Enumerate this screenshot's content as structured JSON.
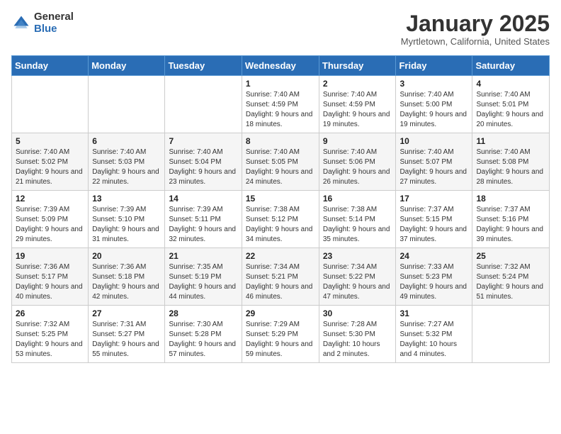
{
  "header": {
    "logo_general": "General",
    "logo_blue": "Blue",
    "month_title": "January 2025",
    "location": "Myrtletown, California, United States"
  },
  "weekdays": [
    "Sunday",
    "Monday",
    "Tuesday",
    "Wednesday",
    "Thursday",
    "Friday",
    "Saturday"
  ],
  "weeks": [
    [
      {
        "day": "",
        "sunrise": "",
        "sunset": "",
        "daylight": ""
      },
      {
        "day": "",
        "sunrise": "",
        "sunset": "",
        "daylight": ""
      },
      {
        "day": "",
        "sunrise": "",
        "sunset": "",
        "daylight": ""
      },
      {
        "day": "1",
        "sunrise": "Sunrise: 7:40 AM",
        "sunset": "Sunset: 4:59 PM",
        "daylight": "Daylight: 9 hours and 18 minutes."
      },
      {
        "day": "2",
        "sunrise": "Sunrise: 7:40 AM",
        "sunset": "Sunset: 4:59 PM",
        "daylight": "Daylight: 9 hours and 19 minutes."
      },
      {
        "day": "3",
        "sunrise": "Sunrise: 7:40 AM",
        "sunset": "Sunset: 5:00 PM",
        "daylight": "Daylight: 9 hours and 19 minutes."
      },
      {
        "day": "4",
        "sunrise": "Sunrise: 7:40 AM",
        "sunset": "Sunset: 5:01 PM",
        "daylight": "Daylight: 9 hours and 20 minutes."
      }
    ],
    [
      {
        "day": "5",
        "sunrise": "Sunrise: 7:40 AM",
        "sunset": "Sunset: 5:02 PM",
        "daylight": "Daylight: 9 hours and 21 minutes."
      },
      {
        "day": "6",
        "sunrise": "Sunrise: 7:40 AM",
        "sunset": "Sunset: 5:03 PM",
        "daylight": "Daylight: 9 hours and 22 minutes."
      },
      {
        "day": "7",
        "sunrise": "Sunrise: 7:40 AM",
        "sunset": "Sunset: 5:04 PM",
        "daylight": "Daylight: 9 hours and 23 minutes."
      },
      {
        "day": "8",
        "sunrise": "Sunrise: 7:40 AM",
        "sunset": "Sunset: 5:05 PM",
        "daylight": "Daylight: 9 hours and 24 minutes."
      },
      {
        "day": "9",
        "sunrise": "Sunrise: 7:40 AM",
        "sunset": "Sunset: 5:06 PM",
        "daylight": "Daylight: 9 hours and 26 minutes."
      },
      {
        "day": "10",
        "sunrise": "Sunrise: 7:40 AM",
        "sunset": "Sunset: 5:07 PM",
        "daylight": "Daylight: 9 hours and 27 minutes."
      },
      {
        "day": "11",
        "sunrise": "Sunrise: 7:40 AM",
        "sunset": "Sunset: 5:08 PM",
        "daylight": "Daylight: 9 hours and 28 minutes."
      }
    ],
    [
      {
        "day": "12",
        "sunrise": "Sunrise: 7:39 AM",
        "sunset": "Sunset: 5:09 PM",
        "daylight": "Daylight: 9 hours and 29 minutes."
      },
      {
        "day": "13",
        "sunrise": "Sunrise: 7:39 AM",
        "sunset": "Sunset: 5:10 PM",
        "daylight": "Daylight: 9 hours and 31 minutes."
      },
      {
        "day": "14",
        "sunrise": "Sunrise: 7:39 AM",
        "sunset": "Sunset: 5:11 PM",
        "daylight": "Daylight: 9 hours and 32 minutes."
      },
      {
        "day": "15",
        "sunrise": "Sunrise: 7:38 AM",
        "sunset": "Sunset: 5:12 PM",
        "daylight": "Daylight: 9 hours and 34 minutes."
      },
      {
        "day": "16",
        "sunrise": "Sunrise: 7:38 AM",
        "sunset": "Sunset: 5:14 PM",
        "daylight": "Daylight: 9 hours and 35 minutes."
      },
      {
        "day": "17",
        "sunrise": "Sunrise: 7:37 AM",
        "sunset": "Sunset: 5:15 PM",
        "daylight": "Daylight: 9 hours and 37 minutes."
      },
      {
        "day": "18",
        "sunrise": "Sunrise: 7:37 AM",
        "sunset": "Sunset: 5:16 PM",
        "daylight": "Daylight: 9 hours and 39 minutes."
      }
    ],
    [
      {
        "day": "19",
        "sunrise": "Sunrise: 7:36 AM",
        "sunset": "Sunset: 5:17 PM",
        "daylight": "Daylight: 9 hours and 40 minutes."
      },
      {
        "day": "20",
        "sunrise": "Sunrise: 7:36 AM",
        "sunset": "Sunset: 5:18 PM",
        "daylight": "Daylight: 9 hours and 42 minutes."
      },
      {
        "day": "21",
        "sunrise": "Sunrise: 7:35 AM",
        "sunset": "Sunset: 5:19 PM",
        "daylight": "Daylight: 9 hours and 44 minutes."
      },
      {
        "day": "22",
        "sunrise": "Sunrise: 7:34 AM",
        "sunset": "Sunset: 5:21 PM",
        "daylight": "Daylight: 9 hours and 46 minutes."
      },
      {
        "day": "23",
        "sunrise": "Sunrise: 7:34 AM",
        "sunset": "Sunset: 5:22 PM",
        "daylight": "Daylight: 9 hours and 47 minutes."
      },
      {
        "day": "24",
        "sunrise": "Sunrise: 7:33 AM",
        "sunset": "Sunset: 5:23 PM",
        "daylight": "Daylight: 9 hours and 49 minutes."
      },
      {
        "day": "25",
        "sunrise": "Sunrise: 7:32 AM",
        "sunset": "Sunset: 5:24 PM",
        "daylight": "Daylight: 9 hours and 51 minutes."
      }
    ],
    [
      {
        "day": "26",
        "sunrise": "Sunrise: 7:32 AM",
        "sunset": "Sunset: 5:25 PM",
        "daylight": "Daylight: 9 hours and 53 minutes."
      },
      {
        "day": "27",
        "sunrise": "Sunrise: 7:31 AM",
        "sunset": "Sunset: 5:27 PM",
        "daylight": "Daylight: 9 hours and 55 minutes."
      },
      {
        "day": "28",
        "sunrise": "Sunrise: 7:30 AM",
        "sunset": "Sunset: 5:28 PM",
        "daylight": "Daylight: 9 hours and 57 minutes."
      },
      {
        "day": "29",
        "sunrise": "Sunrise: 7:29 AM",
        "sunset": "Sunset: 5:29 PM",
        "daylight": "Daylight: 9 hours and 59 minutes."
      },
      {
        "day": "30",
        "sunrise": "Sunrise: 7:28 AM",
        "sunset": "Sunset: 5:30 PM",
        "daylight": "Daylight: 10 hours and 2 minutes."
      },
      {
        "day": "31",
        "sunrise": "Sunrise: 7:27 AM",
        "sunset": "Sunset: 5:32 PM",
        "daylight": "Daylight: 10 hours and 4 minutes."
      },
      {
        "day": "",
        "sunrise": "",
        "sunset": "",
        "daylight": ""
      }
    ]
  ]
}
